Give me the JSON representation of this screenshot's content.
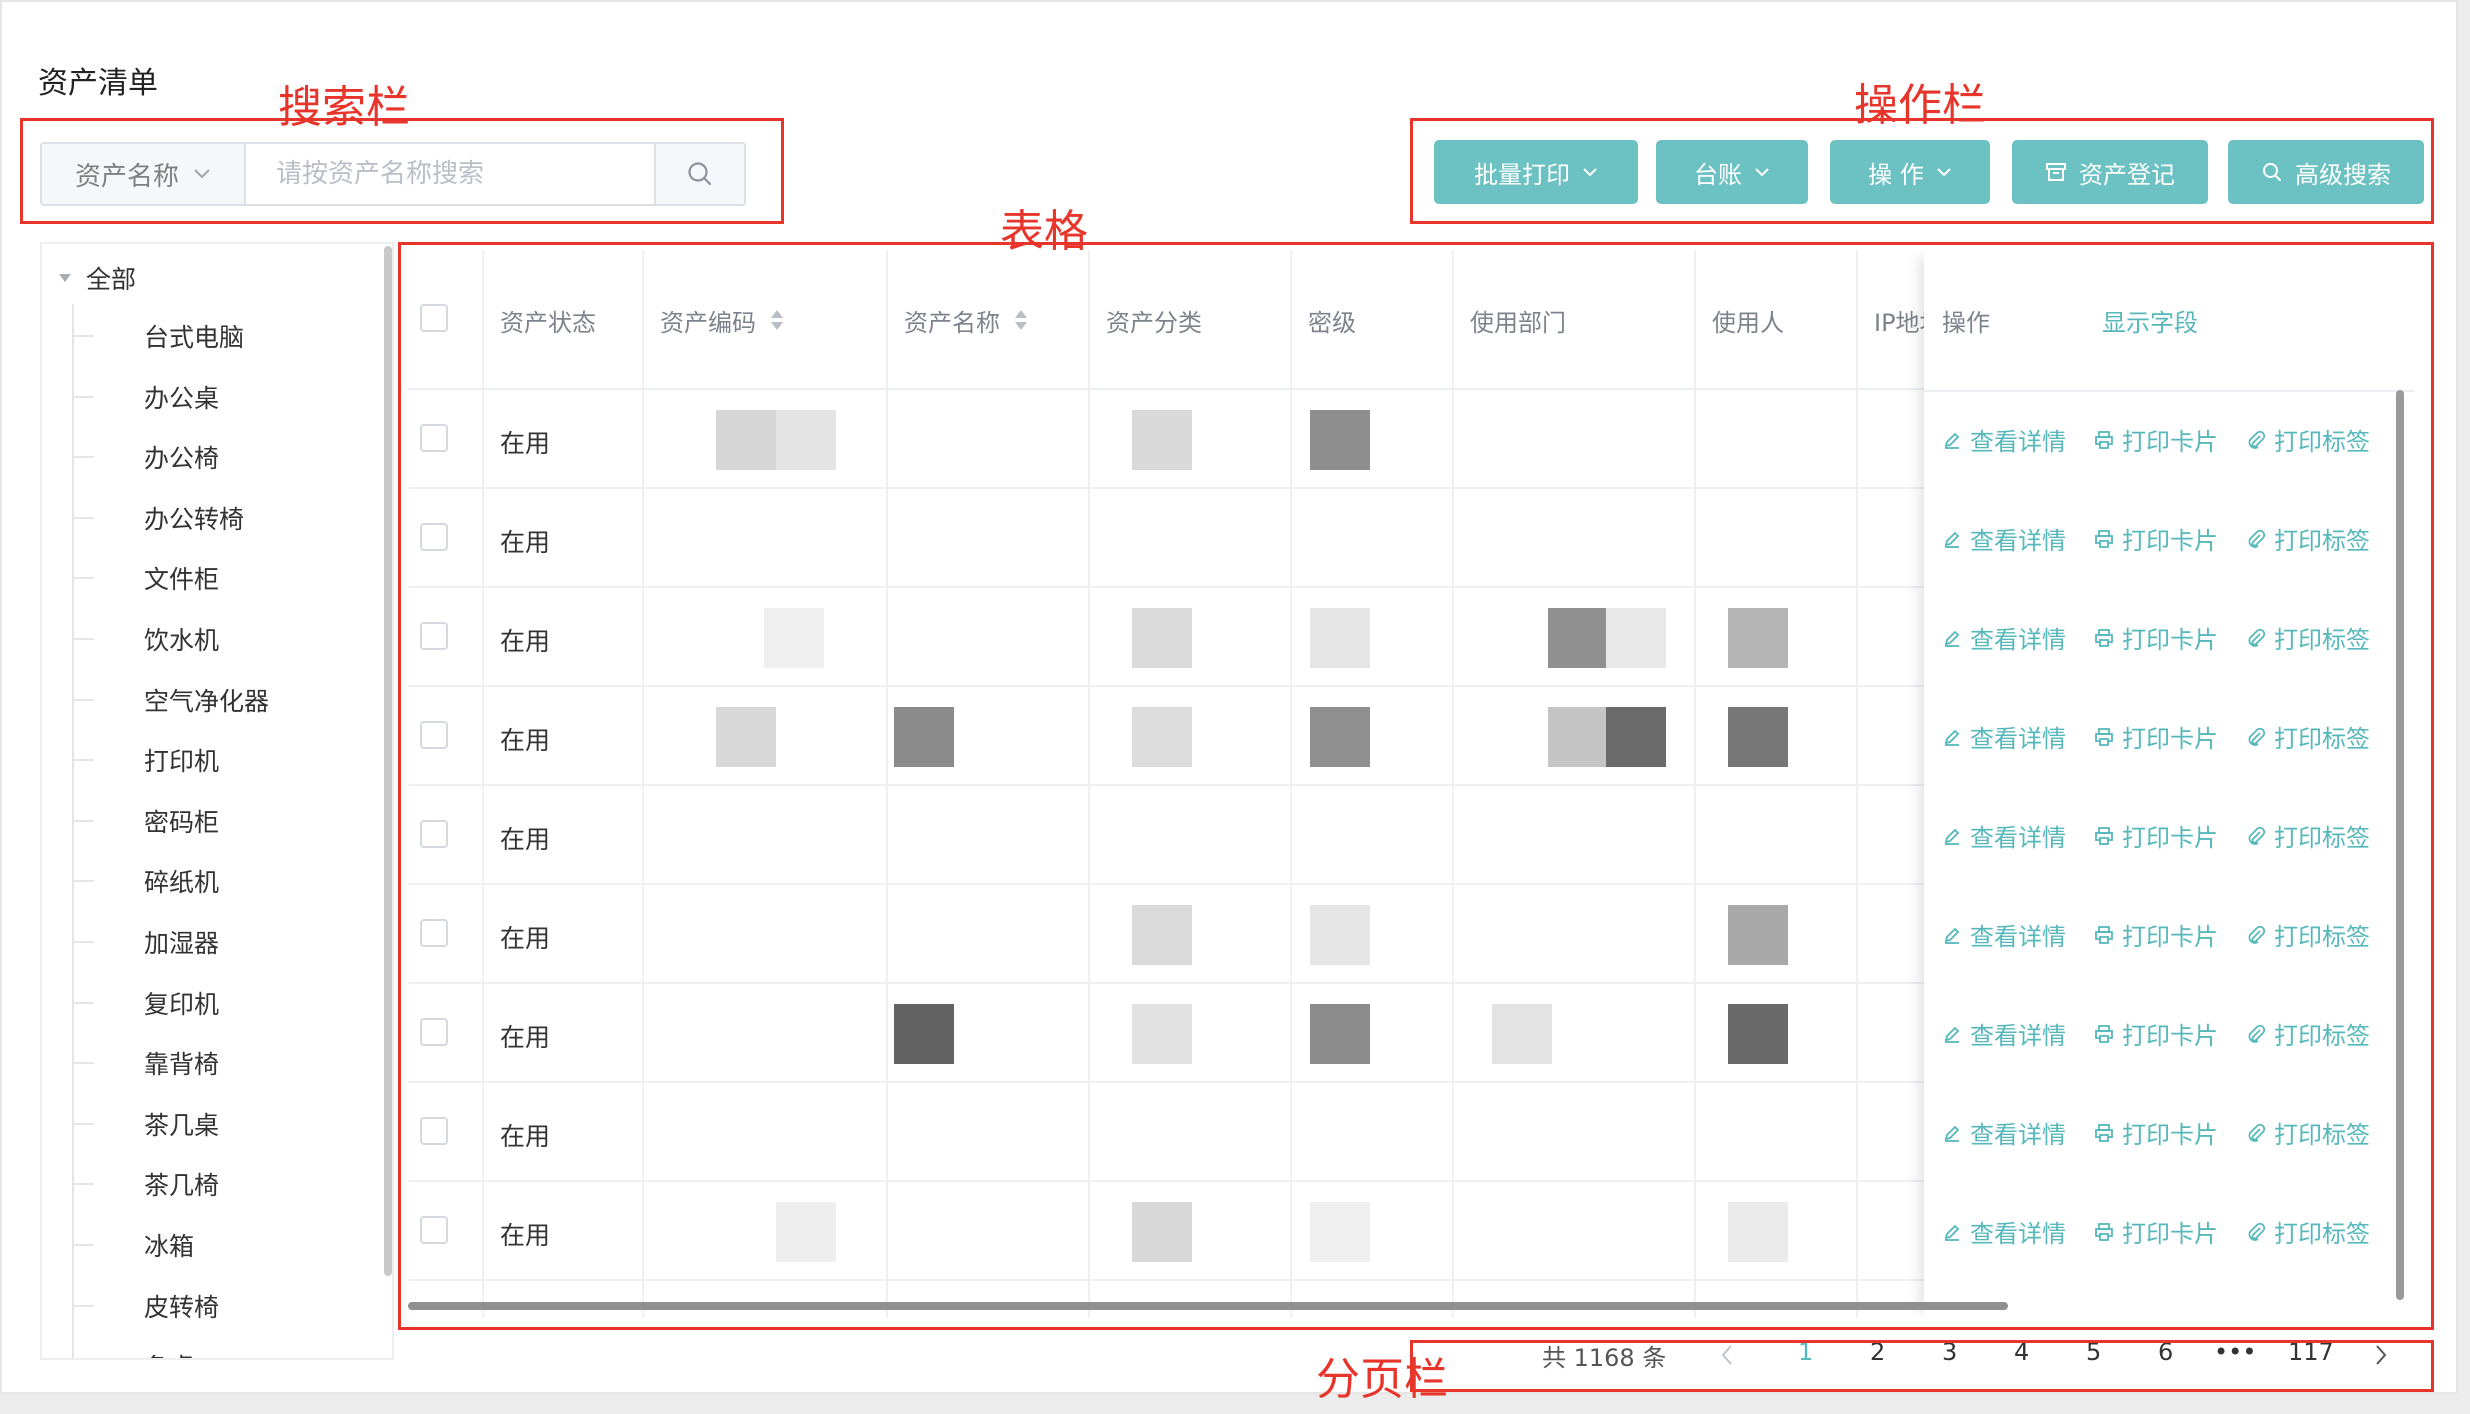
{
  "page": {
    "title": "资产清单"
  },
  "annotations": {
    "search": "搜索栏",
    "toolbar": "操作栏",
    "table": "表格",
    "pagination": "分页栏"
  },
  "search": {
    "field_label": "资产名称",
    "placeholder": "请按资产名称搜索",
    "value": ""
  },
  "toolbar": {
    "batch_print": "批量打印",
    "ledger": "台账",
    "operate": "操 作",
    "register": "资产登记",
    "advanced_search": "高级搜索"
  },
  "tree": {
    "root": "全部",
    "items": [
      "台式电脑",
      "办公桌",
      "办公椅",
      "办公转椅",
      "文件柜",
      "饮水机",
      "空气净化器",
      "打印机",
      "密码柜",
      "碎纸机",
      "加湿器",
      "复印机",
      "靠背椅",
      "茶几桌",
      "茶几椅",
      "冰箱",
      "皮转椅",
      "条桌"
    ]
  },
  "table": {
    "columns": {
      "status": "资产状态",
      "code": "资产编码",
      "name": "资产名称",
      "category": "资产分类",
      "secret": "密级",
      "dept": "使用部门",
      "user": "使用人",
      "ip": "IP地址",
      "actions": "操作",
      "show_fields": "显示字段"
    },
    "rows": [
      {
        "status": "在用"
      },
      {
        "status": "在用"
      },
      {
        "status": "在用"
      },
      {
        "status": "在用"
      },
      {
        "status": "在用"
      },
      {
        "status": "在用"
      },
      {
        "status": "在用"
      },
      {
        "status": "在用"
      },
      {
        "status": "在用"
      }
    ],
    "row_actions": {
      "view": "查看详情",
      "print_card": "打印卡片",
      "print_label": "打印标签"
    }
  },
  "pagination": {
    "total": "共 1168 条",
    "pages": [
      "1",
      "2",
      "3",
      "4",
      "5",
      "6"
    ],
    "ellipsis": "•••",
    "last": "117",
    "current": "1"
  },
  "colors": {
    "accent": "#6cc1c3",
    "link": "#56b8bb",
    "annotation": "#e8352c"
  }
}
